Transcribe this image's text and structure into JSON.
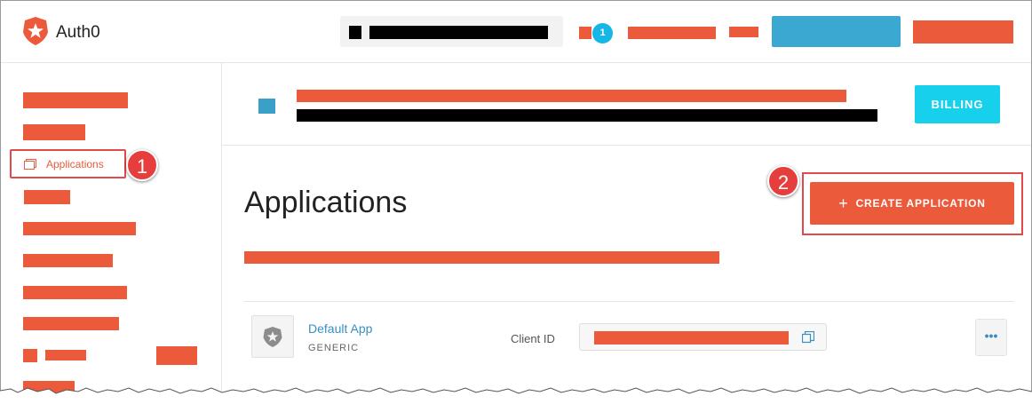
{
  "topbar": {
    "logo_text": "Auth0",
    "notification_count": "1"
  },
  "sidebar": {
    "active_item_label": "Applications"
  },
  "callouts": [
    "1",
    "2"
  ],
  "header": {
    "billing_label": "BILLING"
  },
  "main": {
    "title": "Applications",
    "create_button_label": "CREATE APPLICATION",
    "create_button_icon": "plus-icon"
  },
  "applications": [
    {
      "name": "Default App",
      "type": "GENERIC",
      "client_id_label": "Client ID",
      "more_label": "•••"
    }
  ],
  "colors": {
    "brand_orange": "#eb5a3a",
    "accent_cyan": "#16d0ec",
    "link_blue": "#3a8fc0",
    "callout_red": "#e63d3d"
  }
}
